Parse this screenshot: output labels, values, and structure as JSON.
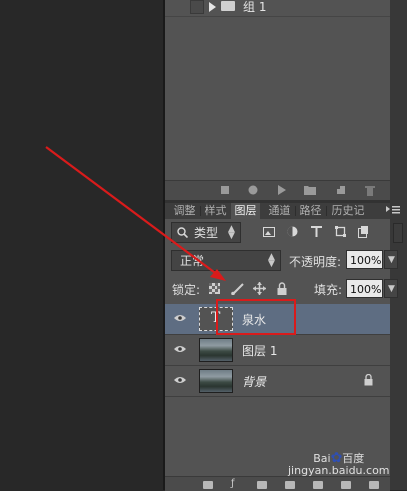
{
  "actions_panel": {
    "group_row": {
      "label": "组 1"
    }
  },
  "panel_tabs": [
    {
      "label": "调整",
      "active": false
    },
    {
      "label": "样式",
      "active": false
    },
    {
      "label": "图层",
      "active": true
    },
    {
      "label": "通道",
      "active": false
    },
    {
      "label": "路径",
      "active": false
    },
    {
      "label": "历史记",
      "active": false
    }
  ],
  "filter": {
    "label": "类型"
  },
  "blend": {
    "mode": "正常",
    "opacity_label": "不透明度:",
    "opacity_value": "100%"
  },
  "lock": {
    "label": "锁定:",
    "fill_label": "填充:",
    "fill_value": "100%"
  },
  "layers": [
    {
      "name": "泉水",
      "kind": "text",
      "thumb_glyph": "T",
      "selected": true,
      "locked": false
    },
    {
      "name": "图层 1",
      "kind": "image",
      "selected": false,
      "locked": false
    },
    {
      "name": "背景",
      "kind": "image",
      "selected": false,
      "locked": true
    }
  ],
  "watermark": {
    "line1": "Bai",
    "line2": "百度",
    "line3": "jingyan.baidu.com"
  },
  "colors": {
    "annotation": "#d91b1b",
    "selection": "#5e6d82",
    "panel": "#535353"
  }
}
